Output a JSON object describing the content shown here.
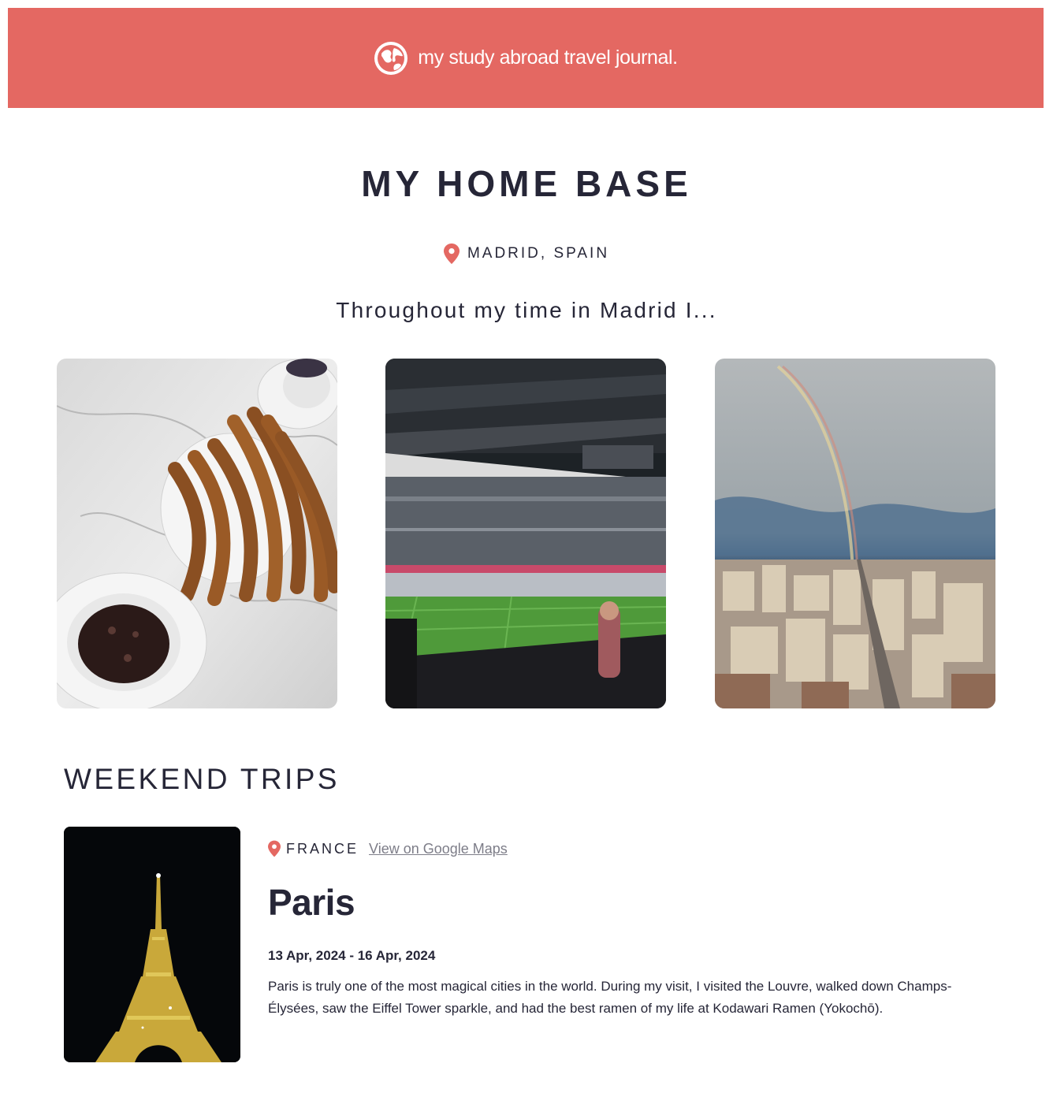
{
  "header": {
    "brand": "my study abroad travel journal.",
    "logo_icon": "globe-icon",
    "background": "#e46862"
  },
  "home": {
    "title": "MY HOME BASE",
    "location": "MADRID, SPAIN",
    "location_icon": "map-pin-icon",
    "intro": "Throughout my time in Madrid I...",
    "photos": [
      {
        "name": "churros-chocolate-photo"
      },
      {
        "name": "football-stadium-photo"
      },
      {
        "name": "madrid-rainbow-skyline-photo"
      }
    ]
  },
  "trips": {
    "heading": "WEEKEND TRIPS",
    "items": [
      {
        "country": "FRANCE",
        "map_link": "View on Google Maps",
        "city": "Paris",
        "dates": "13 Apr, 2024 - 16 Apr, 2024",
        "description": "Paris is truly one of the most magical cities in the world. During my visit, I visited the Louvre, walked down Champs-Élysées, saw the Eiffel Tower sparkle, and had the best ramen of my life at Kodawari Ramen (Yokochō).",
        "photo": "eiffel-tower-night-photo"
      }
    ]
  },
  "colors": {
    "accent": "#e46862",
    "text": "#262637",
    "link": "#7d7d88"
  }
}
